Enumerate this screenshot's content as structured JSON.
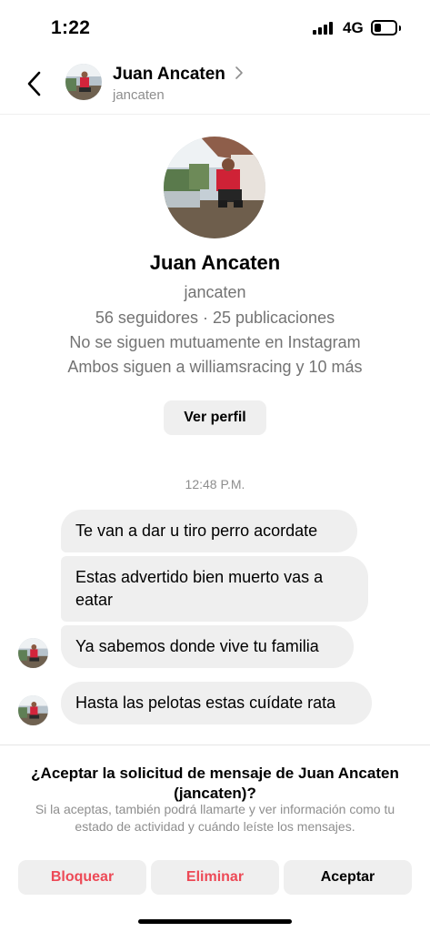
{
  "status_bar": {
    "time": "1:22",
    "network": "4G",
    "battery_level": 0.35
  },
  "header": {
    "name": "Juan Ancaten",
    "username": "jancaten"
  },
  "profile": {
    "name": "Juan Ancaten",
    "username": "jancaten",
    "stats": "56 seguidores · 25 publicaciones",
    "mutual_follow": "No se siguen mutuamente en Instagram",
    "mutual_friends": "Ambos siguen a williamsracing y 10 más",
    "view_profile_label": "Ver perfil"
  },
  "timestamp": "12:48 P.M.",
  "messages": [
    {
      "text": "Te van a dar u  tiro perro acordate"
    },
    {
      "text": "Estas advertido bien  muerto vas a eatar"
    },
    {
      "text": "Ya sabemos donde vive tu familia"
    },
    {
      "text": "Hasta las pelotas estas cuídate rata"
    }
  ],
  "request": {
    "title": "¿Aceptar la solicitud de mensaje de Juan Ancaten (jancaten)?",
    "description": "Si la aceptas, también podrá llamarte y ver información como tu estado de actividad y cuándo leíste los mensajes.",
    "block_label": "Bloquear",
    "delete_label": "Eliminar",
    "accept_label": "Aceptar"
  },
  "colors": {
    "destructive": "#ed4956",
    "bubble": "#efefef",
    "secondary_text": "#737373"
  }
}
